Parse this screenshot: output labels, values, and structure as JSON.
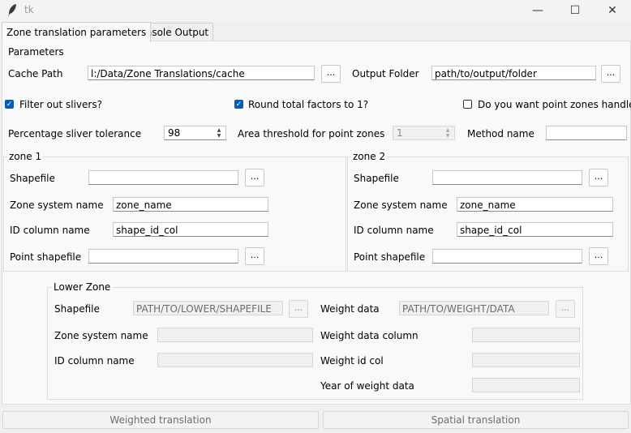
{
  "window": {
    "title": "tk",
    "minimize": "—",
    "maximize": "☐",
    "close": "✕"
  },
  "tabs": [
    {
      "label": "Zone translation parameters",
      "active": true
    },
    {
      "label": "Console Output",
      "active": false
    }
  ],
  "parameters": {
    "group_label": "Parameters",
    "cache_path_label": "Cache Path",
    "cache_path_value": "l:/Data/Zone Translations/cache",
    "output_folder_label": "Output Folder",
    "output_folder_value": "path/to/output/folder",
    "browse": "...",
    "filter_slivers_label": "Filter out slivers?",
    "filter_slivers_checked": true,
    "round_factors_label": "Round total factors to 1?",
    "round_factors_checked": true,
    "point_zones_label": "Do you want point zones handled?",
    "point_zones_checked": false,
    "sliver_tolerance_label": "Percentage sliver tolerance",
    "sliver_tolerance_value": "98",
    "area_threshold_label": "Area threshold for point zones",
    "area_threshold_value": "1",
    "method_name_label": "Method name",
    "method_name_value": ""
  },
  "zone1": {
    "group_label": "zone 1",
    "shapefile_label": "Shapefile",
    "shapefile_value": "",
    "zone_system_label": "Zone system name",
    "zone_system_value": "zone_name",
    "id_column_label": "ID column name",
    "id_column_value": "shape_id_col",
    "point_shapefile_label": "Point shapefile",
    "point_shapefile_value": ""
  },
  "zone2": {
    "group_label": "zone 2",
    "shapefile_label": "Shapefile",
    "shapefile_value": "",
    "zone_system_label": "Zone system name",
    "zone_system_value": "zone_name",
    "id_column_label": "ID column name",
    "id_column_value": "shape_id_col",
    "point_shapefile_label": "Point shapefile",
    "point_shapefile_value": ""
  },
  "lower_zone": {
    "group_label": "Lower Zone",
    "shapefile_label": "Shapefile",
    "shapefile_value": "PATH/TO/LOWER/SHAPEFILE",
    "zone_system_label": "Zone system name",
    "id_column_label": "ID column name",
    "weight_data_label": "Weight data",
    "weight_data_value": "PATH/TO/WEIGHT/DATA",
    "weight_column_label": "Weight data column",
    "weight_id_label": "Weight id col",
    "year_label": "Year of weight data"
  },
  "actions": {
    "weighted": "Weighted translation",
    "spatial": "Spatial translation"
  },
  "colors": {
    "checkbox": "#005fb8",
    "panel": "#f9f9f9",
    "window": "#f0f0f0"
  }
}
